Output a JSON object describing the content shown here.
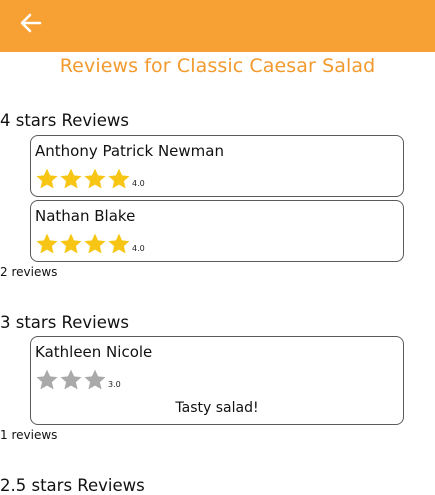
{
  "header": {
    "back_icon": "arrow-left-icon",
    "title": "Reviews for Classic Caesar Salad",
    "bar_color": "#f7a033",
    "title_color": "#f29a2e"
  },
  "colors": {
    "star_filled": "#f7c614",
    "star_empty": "#a9a9a9"
  },
  "groups": [
    {
      "heading": "4 stars Reviews",
      "count_text": "2 reviews",
      "reviews": [
        {
          "name": "Anthony Patrick Newman",
          "rating": 4,
          "rating_text": "4.0",
          "stars_shown": 4,
          "star_color": "filled",
          "comment": ""
        },
        {
          "name": "Nathan Blake",
          "rating": 4,
          "rating_text": "4.0",
          "stars_shown": 4,
          "star_color": "filled",
          "comment": ""
        }
      ]
    },
    {
      "heading": "3 stars Reviews",
      "count_text": "1 reviews",
      "reviews": [
        {
          "name": "Kathleen Nicole",
          "rating": 3,
          "rating_text": "3.0",
          "stars_shown": 3,
          "star_color": "empty",
          "comment": "Tasty salad!"
        }
      ]
    },
    {
      "heading": "2.5 stars Reviews",
      "count_text": "",
      "reviews": []
    }
  ]
}
